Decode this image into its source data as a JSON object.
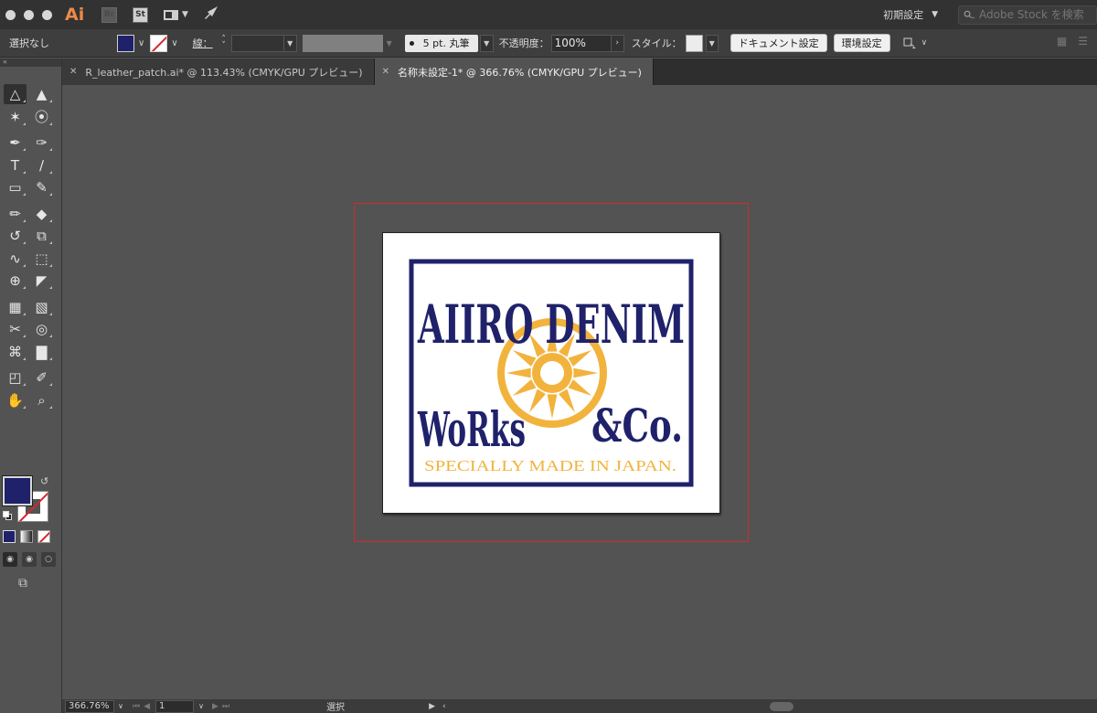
{
  "app": {
    "logo": "Ai",
    "bridge_icon": "Br",
    "stock_icon": "St",
    "workspace_label": "初期設定",
    "stock_search_placeholder": "Adobe Stock を検索"
  },
  "control_bar": {
    "selection_label": "選択なし",
    "fill_color": "#1f226a",
    "stroke_label": "線：",
    "brush_value": "5 pt. 丸筆",
    "opacity_label": "不透明度：",
    "opacity_value": "100%",
    "style_label": "スタイル：",
    "document_settings_button": "ドキュメント設定",
    "preferences_button": "環境設定"
  },
  "tabs": [
    {
      "label": "R_leather_patch.ai* @ 113.43% (CMYK/GPU プレビュー)",
      "active": false
    },
    {
      "label": "名称未設定-1* @ 366.76% (CMYK/GPU プレビュー)",
      "active": true
    }
  ],
  "toolbar": {
    "icons": [
      "selection-tool-icon",
      "direct-selection-tool-icon",
      "magic-wand-tool-icon",
      "lasso-tool-icon",
      "pen-tool-icon",
      "curvature-tool-icon",
      "type-tool-icon",
      "line-segment-tool-icon",
      "rectangle-tool-icon",
      "paintbrush-tool-icon",
      "shaper-tool-icon",
      "eraser-tool-icon",
      "rotate-tool-icon",
      "scale-tool-icon",
      "warp-tool-icon",
      "free-transform-tool-icon",
      "shape-builder-tool-icon",
      "perspective-grid-tool-icon",
      "mesh-tool-icon",
      "gradient-tool-icon",
      "eyedropper-tool-icon",
      "blend-tool-icon",
      "symbol-sprayer-tool-icon",
      "column-graph-tool-icon",
      "artboard-tool-icon",
      "slice-tool-icon",
      "hand-tool-icon",
      "zoom-tool-icon"
    ],
    "fill_color": "#1f226a",
    "stroke_color": "none"
  },
  "artwork": {
    "line1": "AIIRO DENIM",
    "line2_left": "WoRks",
    "line2_right": "&Co.",
    "tagline": "SPECIALLY MADE IN JAPAN.",
    "navy": "#1f226a",
    "gold": "#f2b33d"
  },
  "status_bar": {
    "zoom": "366.76%",
    "page": "1",
    "status": "選択"
  }
}
